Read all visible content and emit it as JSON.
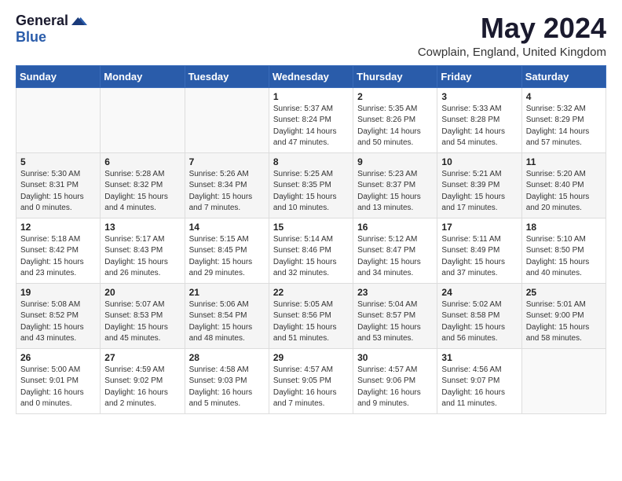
{
  "header": {
    "logo_general": "General",
    "logo_blue": "Blue",
    "month_year": "May 2024",
    "location": "Cowplain, England, United Kingdom"
  },
  "calendar": {
    "headers": [
      "Sunday",
      "Monday",
      "Tuesday",
      "Wednesday",
      "Thursday",
      "Friday",
      "Saturday"
    ],
    "weeks": [
      [
        {
          "day": "",
          "info": ""
        },
        {
          "day": "",
          "info": ""
        },
        {
          "day": "",
          "info": ""
        },
        {
          "day": "1",
          "info": "Sunrise: 5:37 AM\nSunset: 8:24 PM\nDaylight: 14 hours\nand 47 minutes."
        },
        {
          "day": "2",
          "info": "Sunrise: 5:35 AM\nSunset: 8:26 PM\nDaylight: 14 hours\nand 50 minutes."
        },
        {
          "day": "3",
          "info": "Sunrise: 5:33 AM\nSunset: 8:28 PM\nDaylight: 14 hours\nand 54 minutes."
        },
        {
          "day": "4",
          "info": "Sunrise: 5:32 AM\nSunset: 8:29 PM\nDaylight: 14 hours\nand 57 minutes."
        }
      ],
      [
        {
          "day": "5",
          "info": "Sunrise: 5:30 AM\nSunset: 8:31 PM\nDaylight: 15 hours\nand 0 minutes."
        },
        {
          "day": "6",
          "info": "Sunrise: 5:28 AM\nSunset: 8:32 PM\nDaylight: 15 hours\nand 4 minutes."
        },
        {
          "day": "7",
          "info": "Sunrise: 5:26 AM\nSunset: 8:34 PM\nDaylight: 15 hours\nand 7 minutes."
        },
        {
          "day": "8",
          "info": "Sunrise: 5:25 AM\nSunset: 8:35 PM\nDaylight: 15 hours\nand 10 minutes."
        },
        {
          "day": "9",
          "info": "Sunrise: 5:23 AM\nSunset: 8:37 PM\nDaylight: 15 hours\nand 13 minutes."
        },
        {
          "day": "10",
          "info": "Sunrise: 5:21 AM\nSunset: 8:39 PM\nDaylight: 15 hours\nand 17 minutes."
        },
        {
          "day": "11",
          "info": "Sunrise: 5:20 AM\nSunset: 8:40 PM\nDaylight: 15 hours\nand 20 minutes."
        }
      ],
      [
        {
          "day": "12",
          "info": "Sunrise: 5:18 AM\nSunset: 8:42 PM\nDaylight: 15 hours\nand 23 minutes."
        },
        {
          "day": "13",
          "info": "Sunrise: 5:17 AM\nSunset: 8:43 PM\nDaylight: 15 hours\nand 26 minutes."
        },
        {
          "day": "14",
          "info": "Sunrise: 5:15 AM\nSunset: 8:45 PM\nDaylight: 15 hours\nand 29 minutes."
        },
        {
          "day": "15",
          "info": "Sunrise: 5:14 AM\nSunset: 8:46 PM\nDaylight: 15 hours\nand 32 minutes."
        },
        {
          "day": "16",
          "info": "Sunrise: 5:12 AM\nSunset: 8:47 PM\nDaylight: 15 hours\nand 34 minutes."
        },
        {
          "day": "17",
          "info": "Sunrise: 5:11 AM\nSunset: 8:49 PM\nDaylight: 15 hours\nand 37 minutes."
        },
        {
          "day": "18",
          "info": "Sunrise: 5:10 AM\nSunset: 8:50 PM\nDaylight: 15 hours\nand 40 minutes."
        }
      ],
      [
        {
          "day": "19",
          "info": "Sunrise: 5:08 AM\nSunset: 8:52 PM\nDaylight: 15 hours\nand 43 minutes."
        },
        {
          "day": "20",
          "info": "Sunrise: 5:07 AM\nSunset: 8:53 PM\nDaylight: 15 hours\nand 45 minutes."
        },
        {
          "day": "21",
          "info": "Sunrise: 5:06 AM\nSunset: 8:54 PM\nDaylight: 15 hours\nand 48 minutes."
        },
        {
          "day": "22",
          "info": "Sunrise: 5:05 AM\nSunset: 8:56 PM\nDaylight: 15 hours\nand 51 minutes."
        },
        {
          "day": "23",
          "info": "Sunrise: 5:04 AM\nSunset: 8:57 PM\nDaylight: 15 hours\nand 53 minutes."
        },
        {
          "day": "24",
          "info": "Sunrise: 5:02 AM\nSunset: 8:58 PM\nDaylight: 15 hours\nand 56 minutes."
        },
        {
          "day": "25",
          "info": "Sunrise: 5:01 AM\nSunset: 9:00 PM\nDaylight: 15 hours\nand 58 minutes."
        }
      ],
      [
        {
          "day": "26",
          "info": "Sunrise: 5:00 AM\nSunset: 9:01 PM\nDaylight: 16 hours\nand 0 minutes."
        },
        {
          "day": "27",
          "info": "Sunrise: 4:59 AM\nSunset: 9:02 PM\nDaylight: 16 hours\nand 2 minutes."
        },
        {
          "day": "28",
          "info": "Sunrise: 4:58 AM\nSunset: 9:03 PM\nDaylight: 16 hours\nand 5 minutes."
        },
        {
          "day": "29",
          "info": "Sunrise: 4:57 AM\nSunset: 9:05 PM\nDaylight: 16 hours\nand 7 minutes."
        },
        {
          "day": "30",
          "info": "Sunrise: 4:57 AM\nSunset: 9:06 PM\nDaylight: 16 hours\nand 9 minutes."
        },
        {
          "day": "31",
          "info": "Sunrise: 4:56 AM\nSunset: 9:07 PM\nDaylight: 16 hours\nand 11 minutes."
        },
        {
          "day": "",
          "info": ""
        }
      ]
    ]
  }
}
